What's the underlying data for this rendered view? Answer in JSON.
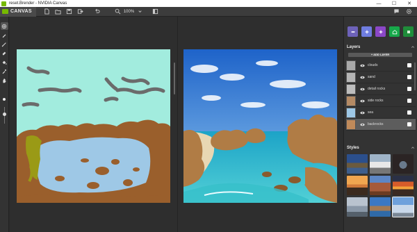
{
  "window": {
    "title": "reset.Brender - NVIDIA Canvas",
    "minimize_glyph": "—",
    "maximize_glyph": "☐",
    "close_glyph": "✕"
  },
  "toolbar": {
    "brand": "CANVAS",
    "zoom_value": "100%",
    "icons": [
      "new-file-icon",
      "open-folder-icon",
      "save-icon",
      "export-icon",
      "undo-icon",
      "zoom-icon",
      "chevron-down-icon",
      "panel-toggle-icon",
      "feedback-icon",
      "settings-icon"
    ]
  },
  "tools": [
    "move-tool",
    "brush-tool",
    "line-tool",
    "eraser-tool",
    "fill-tool",
    "eyedropper-tool",
    "pan-tool"
  ],
  "palette": {
    "buttons": [
      {
        "name": "mode-material",
        "color": "#6d62b9",
        "icon": "minus-icon"
      },
      {
        "name": "mode-add",
        "color": "#6f7de0",
        "icon": "plus-icon"
      },
      {
        "name": "mode-sparkle",
        "color": "#8b47c7",
        "icon": "sparkle-icon"
      },
      {
        "name": "mode-home",
        "color": "#17a84a",
        "icon": "home-icon"
      },
      {
        "name": "mode-swatch",
        "color": "#1f8c3a",
        "icon": "square-icon"
      }
    ]
  },
  "layers_panel": {
    "title": "Layers",
    "add_label": "+ ADD LAYER",
    "items": [
      {
        "name": "clouds",
        "thumb": "#a9a9a9",
        "active": false
      },
      {
        "name": "sand",
        "thumb": "#b5b5b5",
        "active": false
      },
      {
        "name": "detail rocks",
        "thumb": "#bdbdbd",
        "active": false
      },
      {
        "name": "side rocks",
        "thumb": "#b48a64",
        "active": false
      },
      {
        "name": "sea",
        "thumb": "#9ec8e6",
        "active": false
      },
      {
        "name": "backrocks",
        "thumb": "#c08a5a",
        "active": true
      }
    ]
  },
  "styles_panel": {
    "title": "Styles",
    "thumbs": [
      {
        "name": "style-mountain-lake",
        "color": "#3e5e8c"
      },
      {
        "name": "style-snowy-peaks",
        "color": "#c7c7c4"
      },
      {
        "name": "style-rock-arch",
        "color": "#2b2424"
      },
      {
        "name": "style-sunset-plains",
        "color": "#d07a3a"
      },
      {
        "name": "style-red-desert",
        "color": "#a65a3a"
      },
      {
        "name": "style-orange-sky",
        "color": "#d65c2a"
      },
      {
        "name": "style-misty-lake",
        "color": "#8a98a8"
      },
      {
        "name": "style-blue-cliffs",
        "color": "#3b78c4"
      },
      {
        "name": "style-winter-field",
        "color": "#c9d8ea"
      }
    ]
  }
}
